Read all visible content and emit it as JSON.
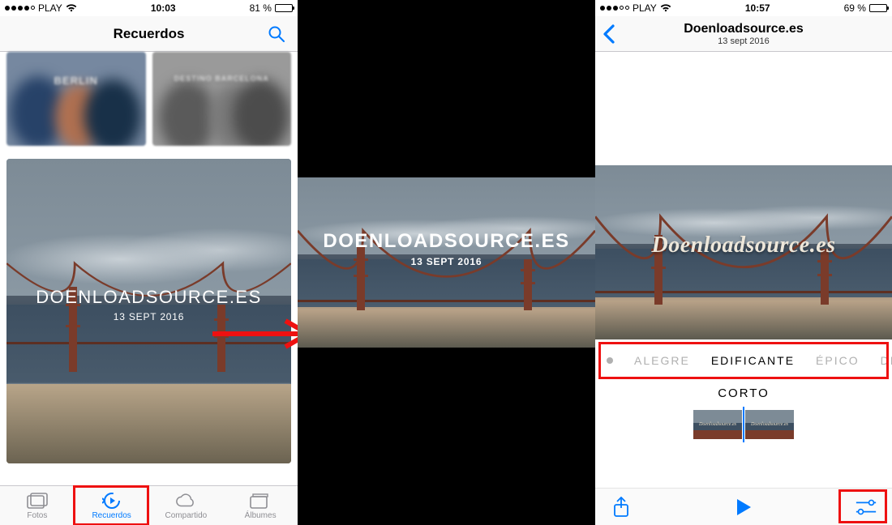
{
  "panel1": {
    "status": {
      "carrier": "PLAY",
      "time": "10:03",
      "battery_pct": "81 %",
      "battery_fill": 81
    },
    "nav_title": "Recuerdos",
    "blur_tiles": [
      {
        "caption": "BERLIN"
      },
      {
        "caption": "DESTINO BARCELONA"
      }
    ],
    "memory": {
      "title": "DOENLOADSOURCE.ES",
      "date": "13 SEPT 2016"
    },
    "tabs": {
      "fotos": "Fotos",
      "recuerdos": "Recuerdos",
      "compartido": "Compartido",
      "albumes": "Álbumes"
    }
  },
  "panel2": {
    "memory": {
      "title": "DOENLOADSOURCE.ES",
      "date": "13 SEPT 2016"
    }
  },
  "panel3": {
    "status": {
      "carrier": "PLAY",
      "time": "10:57",
      "battery_pct": "69 %",
      "battery_fill": 69
    },
    "nav_title": "Doenloadsource.es",
    "nav_subtitle": "13 sept 2016",
    "preview_title": "Doenloadsource.es",
    "moods": {
      "alegre": "ALEGRE",
      "edificante": "EDIFICANTE",
      "epico": "ÉPICO",
      "diver": "DIVER"
    },
    "length": "CORTO",
    "thumb_label": "Doenloadsource.es"
  }
}
